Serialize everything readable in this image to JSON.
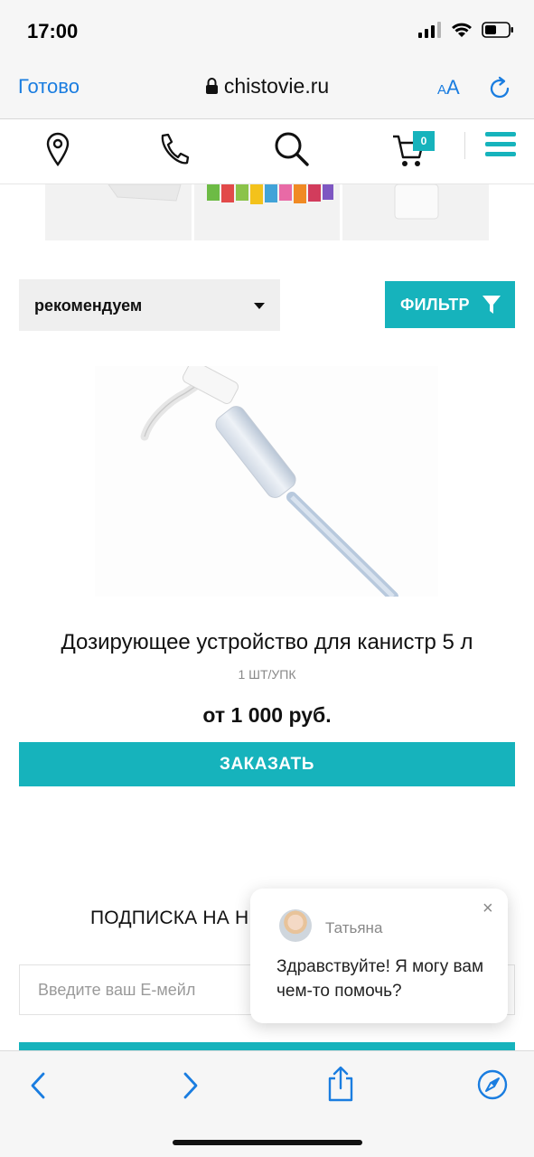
{
  "status_bar": {
    "time": "17:00",
    "icons": [
      "signal-icon",
      "wifi-icon",
      "battery-icon"
    ]
  },
  "browser": {
    "done_label": "Готово",
    "domain": "chistovie.ru",
    "text_size_label_small": "A",
    "text_size_label_large": "A",
    "icons": [
      "lock-icon",
      "reload-icon"
    ]
  },
  "site_nav": {
    "icons": [
      "location-pin-icon",
      "phone-icon",
      "search-icon",
      "cart-icon",
      "menu-icon"
    ],
    "cart_count": "0"
  },
  "sort": {
    "selected": "рекомендуем"
  },
  "filter": {
    "label": "ФИЛЬТР",
    "icon": "funnel-icon"
  },
  "product": {
    "name": "Дозирующее устройство для канистр 5 л",
    "unit": "1 ШТ/УПК",
    "price": "от 1 000 руб.",
    "order_label": "ЗАКАЗАТЬ"
  },
  "subscribe": {
    "title": "ПОДПИСКА НА Н",
    "email_placeholder": "Введите ваш E-мейл"
  },
  "chat": {
    "agent_name": "Татьяна",
    "message": "Здравствуйте! Я могу вам чем-то помочь?",
    "close_symbol": "×"
  },
  "toolbar": {
    "icons": [
      "back-icon",
      "forward-icon",
      "share-icon",
      "compass-icon"
    ]
  },
  "colors": {
    "accent": "#16b3bc",
    "link_blue": "#1a7de0"
  }
}
